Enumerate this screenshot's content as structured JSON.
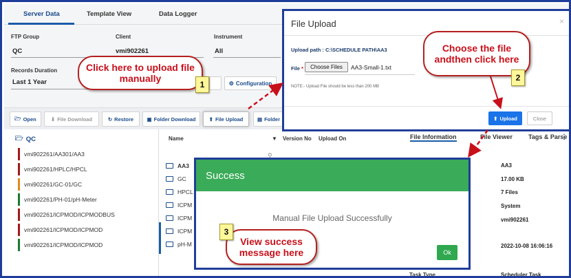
{
  "tabs": [
    "Server Data",
    "Template View",
    "Data Logger"
  ],
  "filters": {
    "ftp_group_label": "FTP Group",
    "ftp_group_value": "QC",
    "client_label": "Client",
    "client_value": "vmi902261",
    "instrument_label": "Instrument",
    "instrument_value": "All",
    "records_duration_label": "Records Duration",
    "records_duration_value": "Last 1 Year",
    "configuration_label": "Configuration"
  },
  "toolbar": {
    "open": "Open",
    "file_download": "File Download",
    "restore": "Restore",
    "folder_download": "Folder Download",
    "file_upload": "File Upload",
    "folder": "Folder"
  },
  "tree": {
    "root": "QC",
    "items": [
      {
        "label": "vmi902261/AA301/AA3",
        "color": "#a11a1a"
      },
      {
        "label": "vmi902261/HPLC/HPCL",
        "color": "#a11a1a"
      },
      {
        "label": "vmi902261/GC-01/GC",
        "color": "#e08a1e"
      },
      {
        "label": "vmi902261/PH-01/pH-Meter",
        "color": "#1b7a2e"
      },
      {
        "label": "vmi902261/ICPMOD/ICPMODBUS",
        "color": "#a11a1a"
      },
      {
        "label": "vmi902261/ICPMOD/ICPMOD",
        "color": "#a11a1a"
      },
      {
        "label": "vmi902261/ICPMOD/ICPMOD",
        "color": "#1b7a2e"
      }
    ]
  },
  "filelist": {
    "name_header": "Name",
    "version_header": "Version No",
    "upload_header": "Upload On",
    "rows": [
      "AA3",
      "GC",
      "HPCL",
      "ICPM",
      "ICPM",
      "ICPM",
      "pH-M"
    ]
  },
  "info": {
    "tabs": [
      "File Information",
      "File Viewer",
      "Tags & Parse"
    ],
    "values": [
      "AA3",
      "17.00 KB",
      "7 Files",
      "System",
      "vmi902261",
      "2022-10-08 16:06:16",
      "Scheduler Task"
    ],
    "task_type_label": "Task Type"
  },
  "upload_dialog": {
    "title": "File Upload",
    "close_x": "×",
    "path": "Upload path : C:\\SCHEDULE PATH\\AA3",
    "file_label": "File",
    "required_mark": "*",
    "choose_files": "Choose Files",
    "file_name": "AA3-Small-1.txt",
    "note": "NOTE:- Upload File should be less than 200 MB",
    "upload_btn": "Upload",
    "close_btn": "Close"
  },
  "success_dialog": {
    "title": "Success",
    "message": "Manual File Upload Successfully",
    "ok": "Ok"
  },
  "callouts": {
    "c1": "Click here to upload file manually",
    "c2": "Choose the file andthen click here",
    "c3": "View success message here",
    "n1": "1",
    "n2": "2",
    "n3": "3"
  },
  "colors": {
    "accent": "#1a5ca8",
    "frame": "#1f3d99",
    "success": "#3aab58",
    "callout": "#c8101a"
  }
}
